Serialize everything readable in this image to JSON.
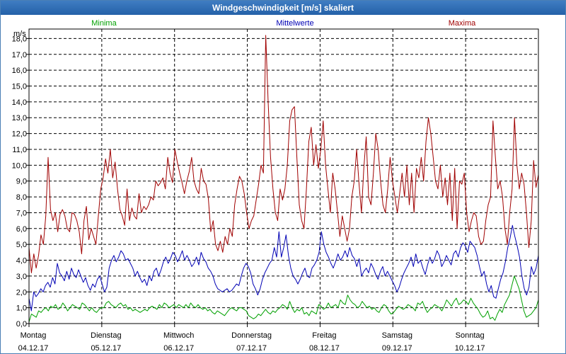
{
  "window": {
    "title": "Windgeschwindigkeit [m/s] skaliert"
  },
  "colors": {
    "minima": "#00a000",
    "mittelwerte": "#0000b4",
    "maxima": "#a00000",
    "grid": "#000000",
    "axis": "#000000"
  },
  "chart_data": {
    "type": "line",
    "title": "Windgeschwindigkeit [m/s] skaliert",
    "ylabel": "m/s",
    "ylim": [
      0,
      18.6
    ],
    "yticks": [
      "0,0",
      "1,0",
      "2,0",
      "3,0",
      "4,0",
      "5,0",
      "6,0",
      "7,0",
      "8,0",
      "9,0",
      "10,0",
      "11,0",
      "12,0",
      "13,0",
      "14,0",
      "15,0",
      "16,0",
      "17,0",
      "18,0"
    ],
    "grid": true,
    "legend_placement": "top",
    "days": [
      {
        "weekday": "Montag",
        "date": "04.12.17"
      },
      {
        "weekday": "Dienstag",
        "date": "05.12.17"
      },
      {
        "weekday": "Mittwoch",
        "date": "06.12.17"
      },
      {
        "weekday": "Donnerstag",
        "date": "07.12.17"
      },
      {
        "weekday": "Freitag",
        "date": "08.12.17"
      },
      {
        "weekday": "Samstag",
        "date": "09.12.17"
      },
      {
        "weekday": "Sonntag",
        "date": "10.12.17"
      }
    ],
    "series": [
      {
        "name": "Minima",
        "values": [
          0.1,
          0.6,
          0.5,
          0.4,
          0.8,
          0.7,
          0.9,
          1.0,
          0.8,
          1.1,
          1.0,
          1.2,
          0.9,
          1.0,
          1.3,
          1.1,
          0.8,
          1.0,
          1.2,
          1.1,
          1.0,
          0.9,
          1.3,
          1.2,
          1.0,
          0.8,
          1.0,
          0.8,
          0.7,
          0.9,
          1.0,
          1.0,
          1.3,
          1.4,
          1.2,
          1.1,
          1.0,
          1.2,
          1.3,
          1.1,
          1.2,
          0.9,
          1.0,
          0.8,
          0.9,
          0.8,
          0.7,
          0.8,
          0.9,
          0.8,
          1.0,
          1.1,
          1.0,
          0.9,
          1.2,
          1.0,
          1.3,
          1.2,
          1.0,
          1.1,
          1.2,
          1.0,
          1.2,
          1.1,
          1.0,
          1.2,
          1.0,
          1.3,
          1.1,
          1.0,
          1.2,
          1.0,
          0.9,
          1.0,
          0.8,
          0.9,
          0.7,
          0.6,
          0.8,
          0.7,
          0.6,
          0.5,
          0.7,
          0.9,
          1.0,
          0.9,
          0.8,
          1.0,
          1.0,
          0.9,
          0.8,
          0.5,
          0.4,
          0.3,
          0.4,
          0.6,
          0.5,
          0.7,
          0.9,
          0.7,
          0.6,
          0.8,
          0.7,
          0.9,
          1.0,
          1.2,
          1.1,
          0.9,
          1.4,
          1.0,
          0.7,
          0.9,
          0.8,
          1.0,
          0.6,
          0.7,
          0.5,
          0.8,
          0.7,
          0.6,
          1.2,
          1.1,
          0.9,
          1.0,
          1.3,
          1.0,
          1.1,
          1.2,
          1.0,
          1.5,
          1.3,
          1.2,
          1.8,
          1.5,
          1.3,
          1.2,
          1.0,
          1.1,
          1.4,
          1.2,
          1.0,
          1.1,
          0.9,
          1.0,
          0.8,
          0.7,
          1.0,
          1.2,
          1.1,
          0.8,
          0.6,
          0.7,
          0.9,
          1.1,
          1.0,
          0.9,
          1.0,
          1.2,
          1.1,
          1.0,
          0.8,
          1.3,
          1.2,
          1.4,
          1.0,
          0.7,
          0.9,
          1.0,
          1.2,
          1.1,
          1.0,
          0.8,
          1.1,
          1.5,
          1.3,
          1.1,
          1.4,
          1.6,
          1.2,
          1.3,
          1.5,
          1.4,
          1.2,
          1.6,
          1.3,
          1.1,
          0.9,
          0.6,
          0.4,
          0.5,
          0.8,
          0.3,
          0.4,
          0.2,
          0.6,
          0.9,
          0.7,
          1.2,
          1.5,
          1.8,
          2.4,
          3.0,
          2.6,
          2.2,
          1.5,
          0.8,
          0.4,
          0.5,
          0.6,
          0.8,
          1.0,
          1.5
        ]
      },
      {
        "name": "Mittelwerte",
        "values": [
          1.6,
          0.8,
          2.0,
          1.7,
          1.9,
          2.2,
          2.0,
          2.4,
          2.6,
          2.3,
          2.9,
          2.5,
          3.8,
          3.2,
          3.0,
          2.7,
          3.3,
          2.8,
          3.5,
          3.1,
          2.9,
          3.4,
          3.0,
          2.6,
          2.9,
          2.4,
          2.1,
          2.5,
          2.3,
          2.8,
          3.0,
          2.5,
          2.0,
          2.3,
          3.5,
          4.0,
          4.3,
          3.9,
          4.2,
          4.6,
          4.4,
          4.0,
          4.1,
          3.8,
          3.5,
          3.0,
          3.3,
          2.9,
          2.6,
          2.8,
          2.4,
          3.0,
          2.7,
          3.3,
          3.5,
          3.0,
          3.4,
          3.9,
          4.2,
          3.8,
          4.1,
          4.5,
          4.3,
          3.9,
          4.2,
          4.6,
          4.0,
          4.3,
          4.0,
          3.6,
          3.8,
          4.2,
          3.7,
          4.5,
          4.1,
          3.9,
          3.5,
          3.3,
          3.0,
          2.5,
          2.2,
          2.1,
          2.0,
          2.1,
          2.2,
          2.0,
          2.1,
          2.3,
          2.5,
          2.4,
          3.0,
          3.5,
          3.8,
          3.6,
          3.2,
          2.5,
          2.2,
          1.8,
          2.2,
          2.8,
          3.2,
          3.5,
          3.8,
          4.0,
          4.8,
          4.2,
          5.8,
          4.2,
          4.8,
          5.6,
          4.3,
          3.5,
          3.0,
          2.8,
          2.5,
          2.8,
          3.2,
          3.5,
          3.0,
          2.9,
          3.5,
          3.7,
          4.0,
          4.5,
          5.8,
          5.0,
          4.5,
          4.2,
          3.8,
          3.5,
          3.9,
          4.4,
          4.0,
          4.2,
          4.6,
          4.2,
          4.8,
          4.3,
          4.1,
          3.6,
          4.1,
          3.0,
          3.3,
          3.5,
          3.2,
          3.8,
          3.5,
          3.1,
          2.8,
          3.3,
          3.6,
          3.0,
          3.3,
          3.0,
          2.7,
          2.4,
          2.0,
          2.3,
          2.8,
          3.2,
          3.5,
          3.8,
          4.2,
          3.6,
          4.4,
          3.8,
          4.0,
          3.5,
          3.1,
          3.7,
          4.2,
          3.8,
          4.1,
          4.6,
          4.3,
          3.6,
          3.9,
          4.3,
          4.0,
          3.7,
          4.4,
          4.6,
          4.2,
          4.8,
          5.1,
          4.9,
          4.5,
          5.2,
          5.0,
          4.8,
          4.3,
          3.6,
          3.0,
          3.3,
          2.5,
          2.0,
          2.4,
          1.7,
          1.6,
          2.2,
          2.8,
          3.2,
          3.9,
          4.8,
          5.4,
          6.2,
          5.5,
          4.9,
          4.2,
          3.0,
          2.2,
          1.8,
          2.3,
          3.6,
          3.1,
          3.5,
          4.3
        ]
      },
      {
        "name": "Maxima",
        "values": [
          4.8,
          3.2,
          4.4,
          3.5,
          4.3,
          5.6,
          5.0,
          6.8,
          10.5,
          7.2,
          6.5,
          7.0,
          5.8,
          6.9,
          7.2,
          6.8,
          6.0,
          5.8,
          7.0,
          6.9,
          6.5,
          5.8,
          4.4,
          6.5,
          7.4,
          5.3,
          6.0,
          5.5,
          5.0,
          6.8,
          8.5,
          9.2,
          10.4,
          9.5,
          11.0,
          9.2,
          10.2,
          8.5,
          7.2,
          6.8,
          6.2,
          8.5,
          6.5,
          7.3,
          6.8,
          6.6,
          8.2,
          7.0,
          7.4,
          7.2,
          7.5,
          8.0,
          7.8,
          9.0,
          8.7,
          8.9,
          9.2,
          8.5,
          10.5,
          9.5,
          8.9,
          11.0,
          10.2,
          9.5,
          8.9,
          8.2,
          9.0,
          9.6,
          10.5,
          9.0,
          8.5,
          8.2,
          9.8,
          9.0,
          8.8,
          7.9,
          5.8,
          6.5,
          5.0,
          4.6,
          5.2,
          4.5,
          5.5,
          5.0,
          6.0,
          5.5,
          7.5,
          8.5,
          9.3,
          9.0,
          8.2,
          7.0,
          6.0,
          6.5,
          6.8,
          7.8,
          8.8,
          10.0,
          9.5,
          18.2,
          14.0,
          10.5,
          8.5,
          7.0,
          6.5,
          8.5,
          7.8,
          8.5,
          10.0,
          12.8,
          13.5,
          13.7,
          10.5,
          7.5,
          6.5,
          6.0,
          8.5,
          11.5,
          12.4,
          10.0,
          11.3,
          9.8,
          11.0,
          12.8,
          10.0,
          8.5,
          7.0,
          9.5,
          8.5,
          7.0,
          5.5,
          6.8,
          6.0,
          5.2,
          6.0,
          8.0,
          9.0,
          11.0,
          8.8,
          7.0,
          9.8,
          11.8,
          8.0,
          7.5,
          9.5,
          12.0,
          11.0,
          9.0,
          7.5,
          7.0,
          8.5,
          10.5,
          9.0,
          8.0,
          7.0,
          8.2,
          9.5,
          8.0,
          10.0,
          7.5,
          9.5,
          7.0,
          9.8,
          9.2,
          10.5,
          9.0,
          11.5,
          13.0,
          12.0,
          10.5,
          9.0,
          8.5,
          10.0,
          8.0,
          9.2,
          7.5,
          9.5,
          6.5,
          9.8,
          6.0,
          9.0,
          8.8,
          9.5,
          7.0,
          5.8,
          6.5,
          7.0,
          6.8,
          5.5,
          5.0,
          5.2,
          6.5,
          7.5,
          8.0,
          12.8,
          10.5,
          8.5,
          9.0,
          8.0,
          6.0,
          5.0,
          7.0,
          8.5,
          13.0,
          10.0,
          8.5,
          9.5,
          8.8,
          7.0,
          4.8,
          6.5,
          10.3,
          8.6,
          9.4
        ]
      }
    ]
  }
}
